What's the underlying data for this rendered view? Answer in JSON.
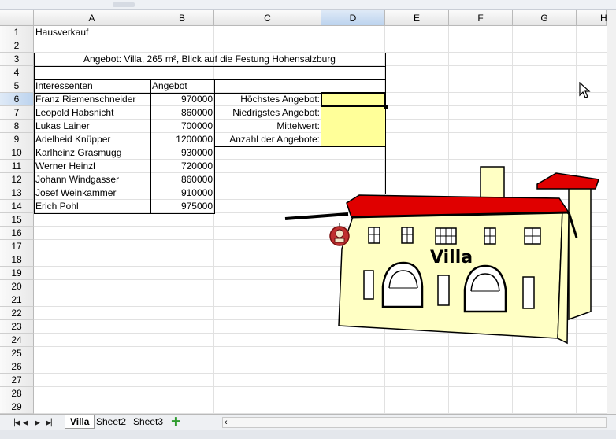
{
  "columns": [
    "A",
    "B",
    "C",
    "D",
    "E",
    "F",
    "G",
    "H"
  ],
  "rows": [
    "1",
    "2",
    "3",
    "4",
    "5",
    "6",
    "7",
    "8",
    "9",
    "10",
    "11",
    "12",
    "13",
    "14",
    "15",
    "16",
    "17",
    "18",
    "19",
    "20",
    "21",
    "22",
    "23",
    "24",
    "25",
    "26",
    "27",
    "28",
    "29"
  ],
  "active_cell": {
    "column": "D",
    "row": "6"
  },
  "sheet": {
    "title": "Hausverkauf",
    "offer": "Angebot: Villa, 265 m², Blick auf die Festung Hohensalzburg",
    "header_name": "Interessenten",
    "header_offer": "Angebot",
    "bidders": [
      {
        "name": "Franz Riemenschneider",
        "offer": "970000"
      },
      {
        "name": "Leopold Habsnicht",
        "offer": "860000"
      },
      {
        "name": "Lukas Lainer",
        "offer": "700000"
      },
      {
        "name": "Adelheid Knüpper",
        "offer": "1200000"
      },
      {
        "name": "Karlheinz Grasmugg",
        "offer": "930000"
      },
      {
        "name": "Werner Heinzl",
        "offer": "720000"
      },
      {
        "name": "Johann Windgasser",
        "offer": "860000"
      },
      {
        "name": "Josef Weinkammer",
        "offer": "910000"
      },
      {
        "name": "Erich Pohl",
        "offer": "975000"
      }
    ],
    "stats_labels": [
      "Höchstes Angebot:",
      "Niedrigstes Angebot:",
      "Mittelwert:",
      "Anzahl der Angebote:"
    ]
  },
  "drawing": {
    "sign_text": "Villa"
  },
  "tabs": [
    "Villa",
    "Sheet2",
    "Sheet3"
  ],
  "add_sheet_icon": "plus-icon",
  "colors": {
    "highlight": "#ffff99",
    "roof": "#e00000",
    "wall": "#ffffc4",
    "header_active": "#bcd3ee"
  }
}
